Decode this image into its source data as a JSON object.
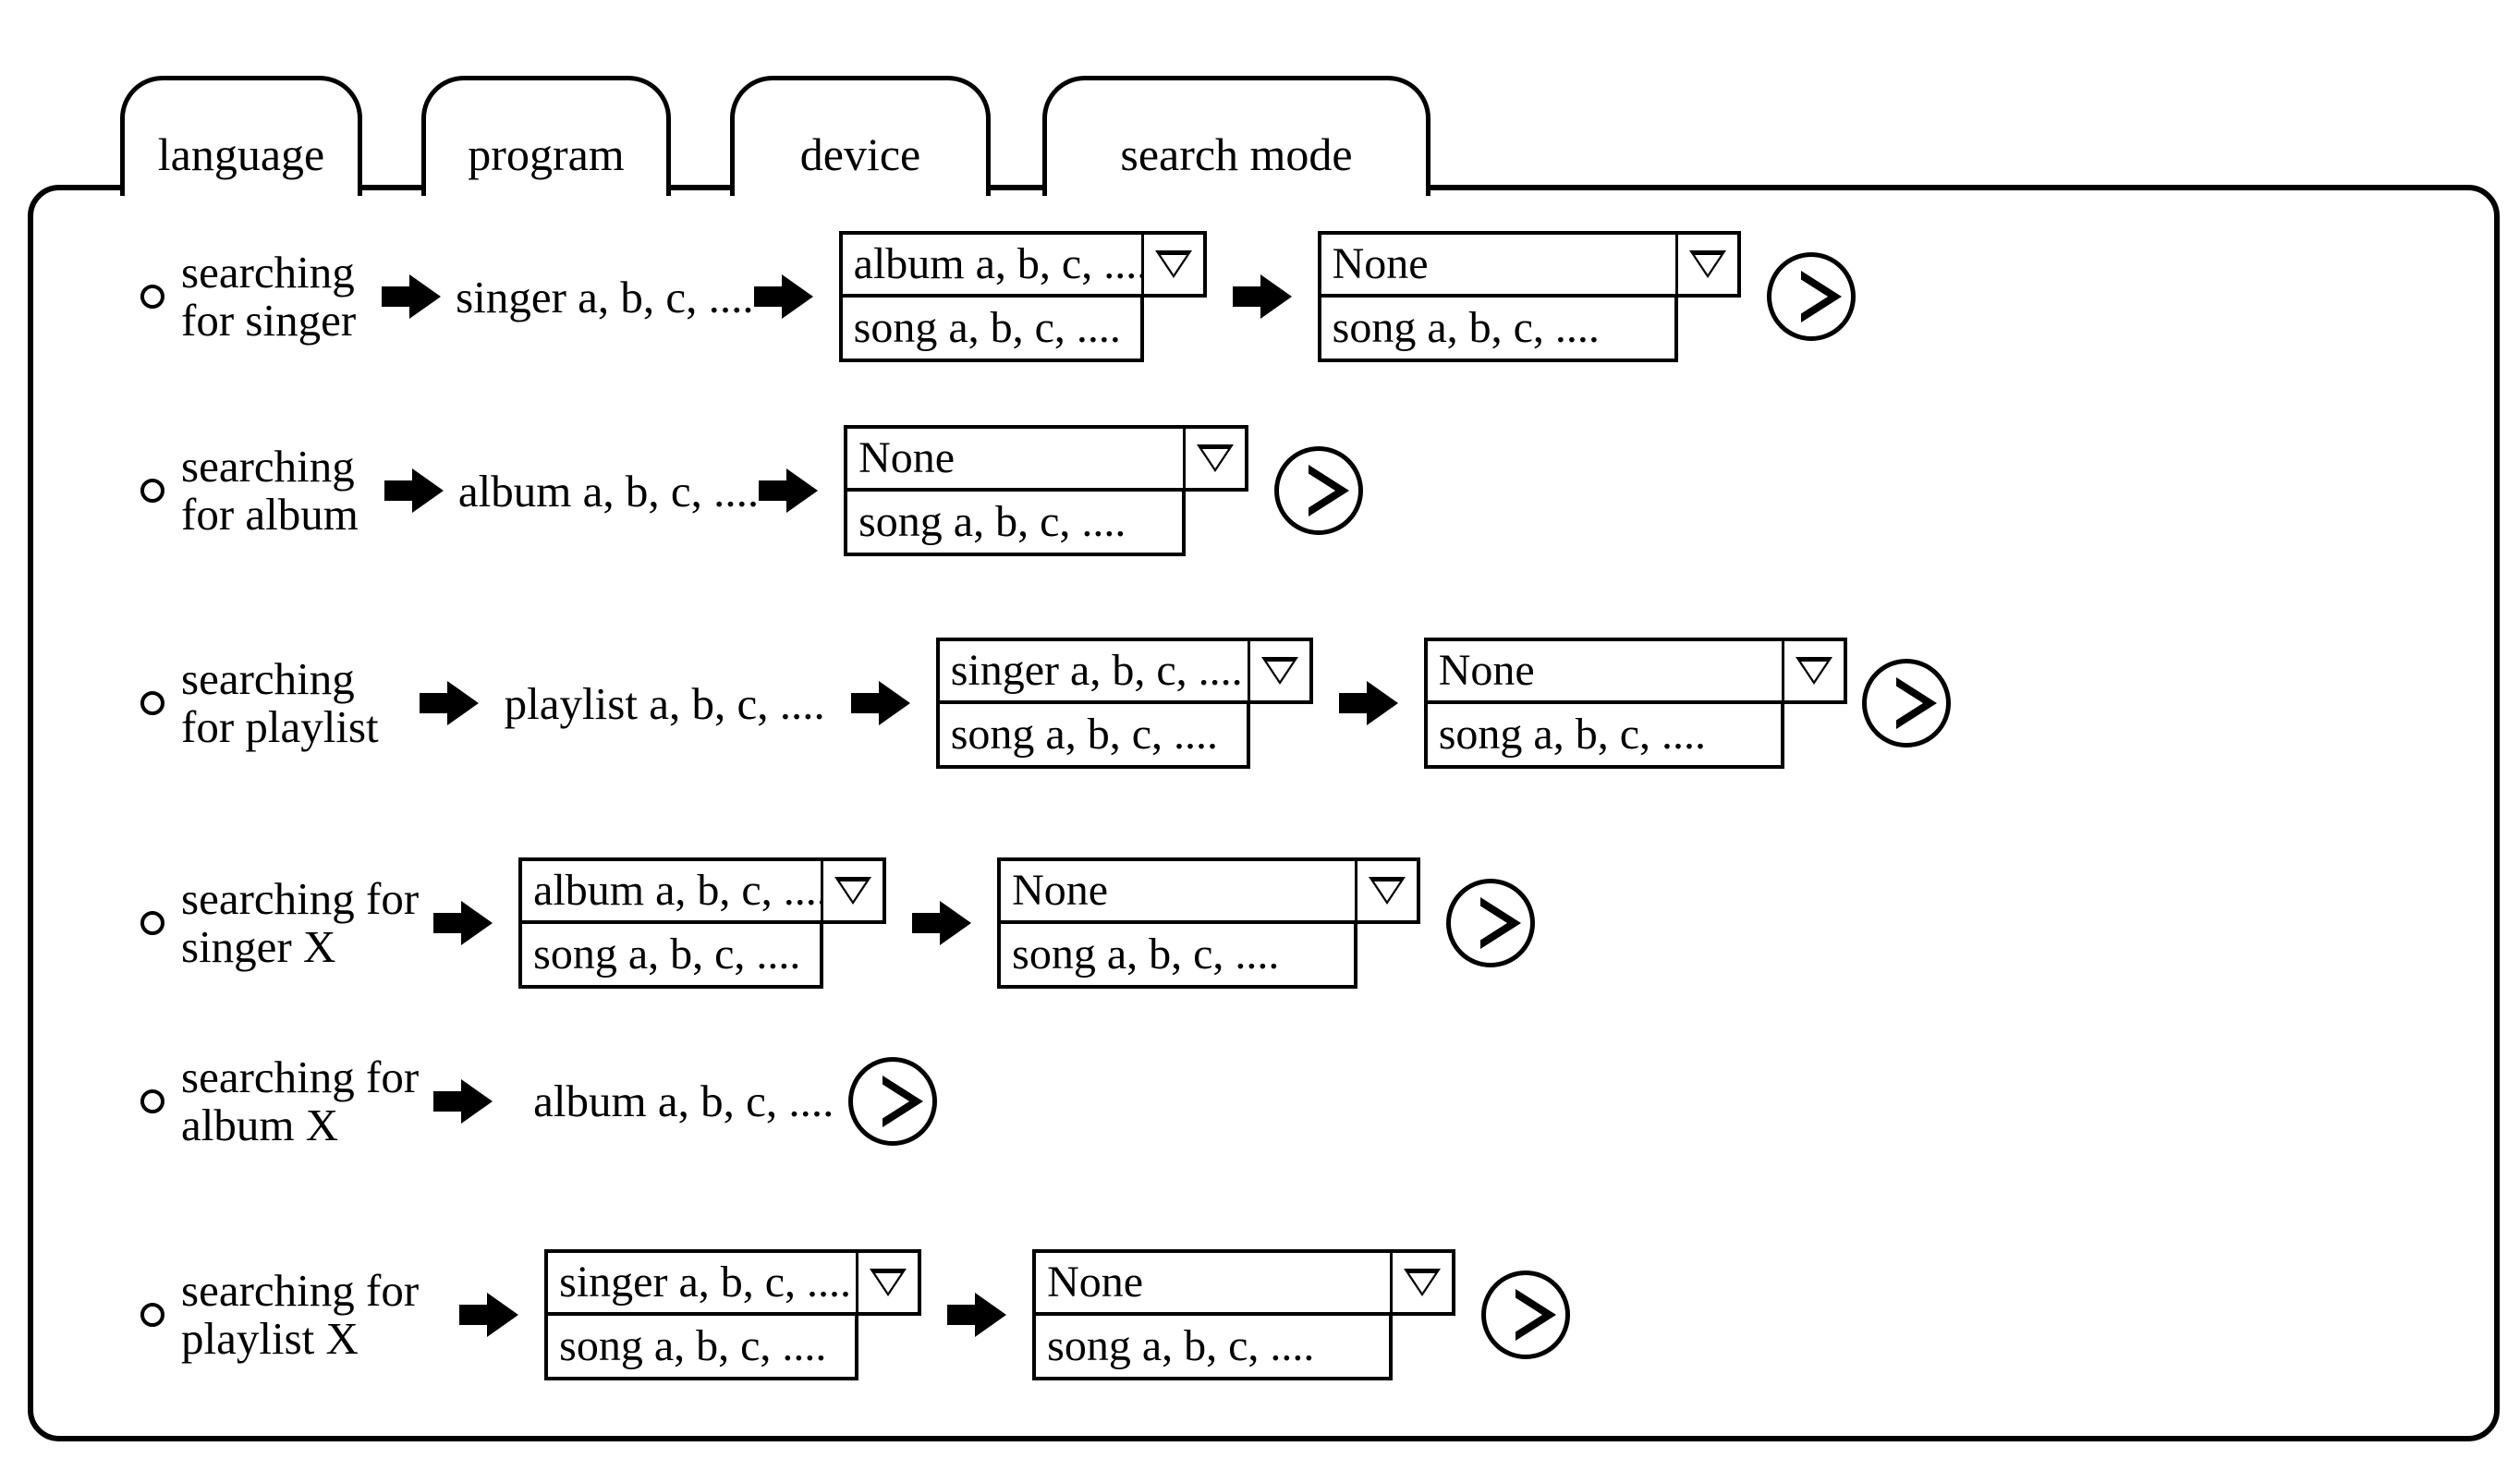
{
  "tabs": [
    {
      "label": "language"
    },
    {
      "label": "program"
    },
    {
      "label": "device"
    },
    {
      "label": "search mode"
    }
  ],
  "rows": [
    {
      "label_line1": "searching",
      "label_line2": "for singer",
      "token": "singer a, b, c, ....",
      "dropdown1_value": "album a, b, c, ....",
      "dropdown1_item": "song a, b, c, ....",
      "dropdown2_value": "None",
      "dropdown2_item": "song a, b, c, ....",
      "play": "play"
    },
    {
      "label_line1": "searching",
      "label_line2": "for album",
      "token": "album a, b, c, ....",
      "dropdown1_value": "None",
      "dropdown1_item": "song a, b, c, ....",
      "play": "play"
    },
    {
      "label_line1": "searching",
      "label_line2": "for playlist",
      "token": "playlist a, b, c, ....",
      "dropdown1_value": "singer a, b, c, ....",
      "dropdown1_item": "song a, b, c, ....",
      "dropdown2_value": "None",
      "dropdown2_item": "song a, b, c, ....",
      "play": "play"
    },
    {
      "label_line1": "searching for",
      "label_line2": "singer X",
      "dropdown1_value": "album a, b, c, ....",
      "dropdown1_item": "song a, b, c, ....",
      "dropdown2_value": "None",
      "dropdown2_item": "song a, b, c, ....",
      "play": "play"
    },
    {
      "label_line1": "searching for",
      "label_line2": "album X",
      "token": "album a, b, c, ....",
      "play": "play"
    },
    {
      "label_line1": "searching for",
      "label_line2": "playlist X",
      "dropdown1_value": "singer a, b, c, ....",
      "dropdown1_item": "song a, b, c, ....",
      "dropdown2_value": "None",
      "dropdown2_item": "song a, b, c, ....",
      "play": "play"
    }
  ],
  "icons": {
    "arrow": "arrow-right-icon",
    "caret": "chevron-down-icon",
    "play": "play-icon",
    "radio": "radio-button-icon"
  },
  "colors": {
    "stroke": "#000000",
    "background": "#ffffff"
  }
}
